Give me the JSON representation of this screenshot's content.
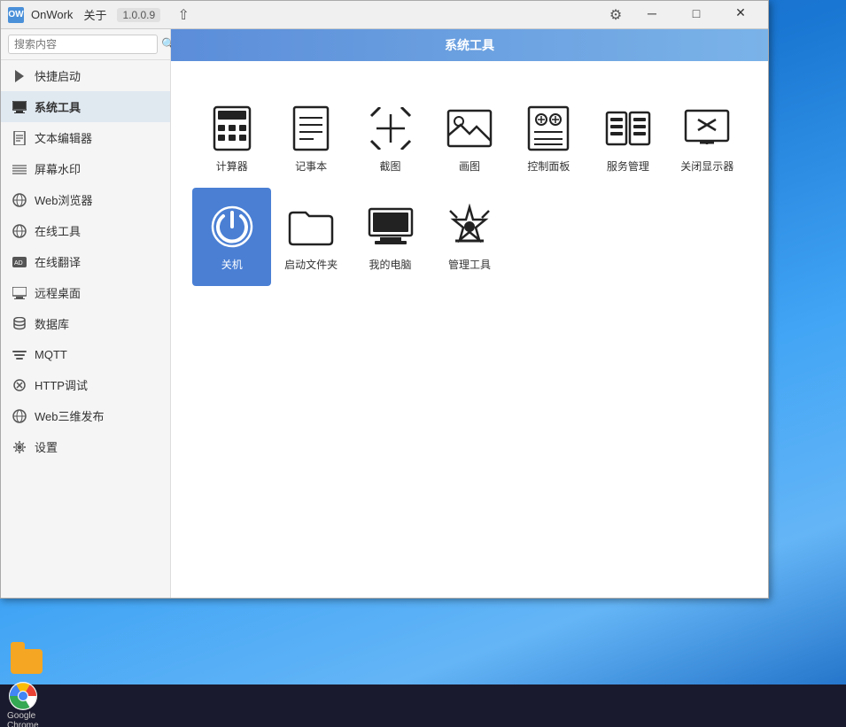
{
  "app": {
    "logo": "OW",
    "name": "OnWork",
    "menu": {
      "about": "关于"
    },
    "version": "1.0.0.9",
    "window_title": "系统工具",
    "controls": {
      "settings": "⚙",
      "minimize": "─",
      "maximize": "□",
      "close": "✕"
    }
  },
  "sidebar": {
    "search_placeholder": "搜索内容",
    "items": [
      {
        "id": "quick-launch",
        "label": "快捷启动",
        "icon": "⚡"
      },
      {
        "id": "system-tools",
        "label": "系统工具",
        "icon": "🖥",
        "active": true
      },
      {
        "id": "text-editor",
        "label": "文本编辑器",
        "icon": "📄"
      },
      {
        "id": "watermark",
        "label": "屏幕水印",
        "icon": "≋"
      },
      {
        "id": "browser",
        "label": "Web浏览器",
        "icon": "🌐"
      },
      {
        "id": "online-tools",
        "label": "在线工具",
        "icon": "🌐"
      },
      {
        "id": "translate",
        "label": "在线翻译",
        "icon": "AD"
      },
      {
        "id": "remote-desktop",
        "label": "远程桌面",
        "icon": "🖥"
      },
      {
        "id": "database",
        "label": "数据库",
        "icon": "🗄"
      },
      {
        "id": "mqtt",
        "label": "MQTT",
        "icon": "📡"
      },
      {
        "id": "http-debug",
        "label": "HTTP调试",
        "icon": "🔄"
      },
      {
        "id": "web3d",
        "label": "Web三维发布",
        "icon": "🌐"
      },
      {
        "id": "settings",
        "label": "设置",
        "icon": "⚙"
      }
    ]
  },
  "content": {
    "header": "系统工具",
    "tools": [
      {
        "id": "calculator",
        "label": "计算器"
      },
      {
        "id": "notepad",
        "label": "记事本"
      },
      {
        "id": "screenshot",
        "label": "截图"
      },
      {
        "id": "image",
        "label": "画图"
      },
      {
        "id": "control-panel",
        "label": "控制面板"
      },
      {
        "id": "services",
        "label": "服务管理"
      },
      {
        "id": "close-display",
        "label": "关闭显示器"
      },
      {
        "id": "shutdown",
        "label": "关机",
        "active": true
      },
      {
        "id": "startup-folder",
        "label": "启动文件夹"
      },
      {
        "id": "my-computer",
        "label": "我的电脑"
      },
      {
        "id": "management-tools",
        "label": "管理工具"
      }
    ]
  },
  "taskbar": {
    "chrome_label": "Google\nChrome"
  },
  "desktop": {
    "folder_label": ""
  }
}
